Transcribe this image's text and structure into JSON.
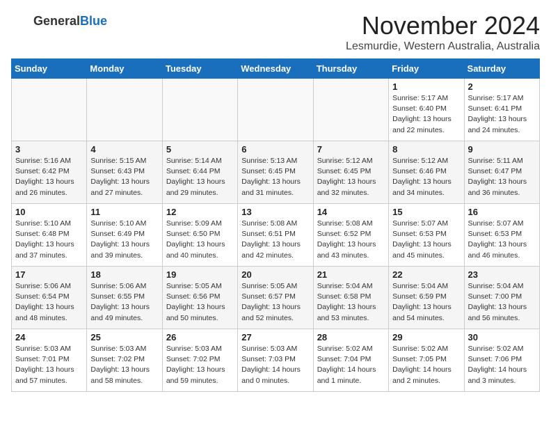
{
  "header": {
    "logo_general": "General",
    "logo_blue": "Blue",
    "month": "November 2024",
    "location": "Lesmurdie, Western Australia, Australia"
  },
  "weekdays": [
    "Sunday",
    "Monday",
    "Tuesday",
    "Wednesday",
    "Thursday",
    "Friday",
    "Saturday"
  ],
  "weeks": [
    [
      {
        "day": "",
        "info": ""
      },
      {
        "day": "",
        "info": ""
      },
      {
        "day": "",
        "info": ""
      },
      {
        "day": "",
        "info": ""
      },
      {
        "day": "",
        "info": ""
      },
      {
        "day": "1",
        "info": "Sunrise: 5:17 AM\nSunset: 6:40 PM\nDaylight: 13 hours\nand 22 minutes."
      },
      {
        "day": "2",
        "info": "Sunrise: 5:17 AM\nSunset: 6:41 PM\nDaylight: 13 hours\nand 24 minutes."
      }
    ],
    [
      {
        "day": "3",
        "info": "Sunrise: 5:16 AM\nSunset: 6:42 PM\nDaylight: 13 hours\nand 26 minutes."
      },
      {
        "day": "4",
        "info": "Sunrise: 5:15 AM\nSunset: 6:43 PM\nDaylight: 13 hours\nand 27 minutes."
      },
      {
        "day": "5",
        "info": "Sunrise: 5:14 AM\nSunset: 6:44 PM\nDaylight: 13 hours\nand 29 minutes."
      },
      {
        "day": "6",
        "info": "Sunrise: 5:13 AM\nSunset: 6:45 PM\nDaylight: 13 hours\nand 31 minutes."
      },
      {
        "day": "7",
        "info": "Sunrise: 5:12 AM\nSunset: 6:45 PM\nDaylight: 13 hours\nand 32 minutes."
      },
      {
        "day": "8",
        "info": "Sunrise: 5:12 AM\nSunset: 6:46 PM\nDaylight: 13 hours\nand 34 minutes."
      },
      {
        "day": "9",
        "info": "Sunrise: 5:11 AM\nSunset: 6:47 PM\nDaylight: 13 hours\nand 36 minutes."
      }
    ],
    [
      {
        "day": "10",
        "info": "Sunrise: 5:10 AM\nSunset: 6:48 PM\nDaylight: 13 hours\nand 37 minutes."
      },
      {
        "day": "11",
        "info": "Sunrise: 5:10 AM\nSunset: 6:49 PM\nDaylight: 13 hours\nand 39 minutes."
      },
      {
        "day": "12",
        "info": "Sunrise: 5:09 AM\nSunset: 6:50 PM\nDaylight: 13 hours\nand 40 minutes."
      },
      {
        "day": "13",
        "info": "Sunrise: 5:08 AM\nSunset: 6:51 PM\nDaylight: 13 hours\nand 42 minutes."
      },
      {
        "day": "14",
        "info": "Sunrise: 5:08 AM\nSunset: 6:52 PM\nDaylight: 13 hours\nand 43 minutes."
      },
      {
        "day": "15",
        "info": "Sunrise: 5:07 AM\nSunset: 6:53 PM\nDaylight: 13 hours\nand 45 minutes."
      },
      {
        "day": "16",
        "info": "Sunrise: 5:07 AM\nSunset: 6:53 PM\nDaylight: 13 hours\nand 46 minutes."
      }
    ],
    [
      {
        "day": "17",
        "info": "Sunrise: 5:06 AM\nSunset: 6:54 PM\nDaylight: 13 hours\nand 48 minutes."
      },
      {
        "day": "18",
        "info": "Sunrise: 5:06 AM\nSunset: 6:55 PM\nDaylight: 13 hours\nand 49 minutes."
      },
      {
        "day": "19",
        "info": "Sunrise: 5:05 AM\nSunset: 6:56 PM\nDaylight: 13 hours\nand 50 minutes."
      },
      {
        "day": "20",
        "info": "Sunrise: 5:05 AM\nSunset: 6:57 PM\nDaylight: 13 hours\nand 52 minutes."
      },
      {
        "day": "21",
        "info": "Sunrise: 5:04 AM\nSunset: 6:58 PM\nDaylight: 13 hours\nand 53 minutes."
      },
      {
        "day": "22",
        "info": "Sunrise: 5:04 AM\nSunset: 6:59 PM\nDaylight: 13 hours\nand 54 minutes."
      },
      {
        "day": "23",
        "info": "Sunrise: 5:04 AM\nSunset: 7:00 PM\nDaylight: 13 hours\nand 56 minutes."
      }
    ],
    [
      {
        "day": "24",
        "info": "Sunrise: 5:03 AM\nSunset: 7:01 PM\nDaylight: 13 hours\nand 57 minutes."
      },
      {
        "day": "25",
        "info": "Sunrise: 5:03 AM\nSunset: 7:02 PM\nDaylight: 13 hours\nand 58 minutes."
      },
      {
        "day": "26",
        "info": "Sunrise: 5:03 AM\nSunset: 7:02 PM\nDaylight: 13 hours\nand 59 minutes."
      },
      {
        "day": "27",
        "info": "Sunrise: 5:03 AM\nSunset: 7:03 PM\nDaylight: 14 hours\nand 0 minutes."
      },
      {
        "day": "28",
        "info": "Sunrise: 5:02 AM\nSunset: 7:04 PM\nDaylight: 14 hours\nand 1 minute."
      },
      {
        "day": "29",
        "info": "Sunrise: 5:02 AM\nSunset: 7:05 PM\nDaylight: 14 hours\nand 2 minutes."
      },
      {
        "day": "30",
        "info": "Sunrise: 5:02 AM\nSunset: 7:06 PM\nDaylight: 14 hours\nand 3 minutes."
      }
    ]
  ]
}
